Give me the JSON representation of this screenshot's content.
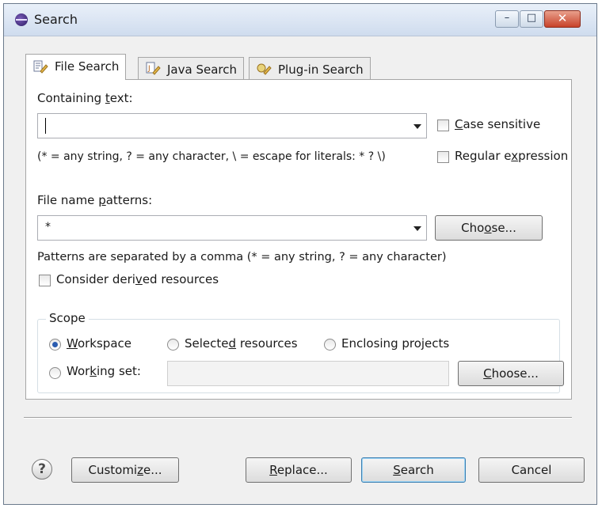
{
  "window": {
    "title": "Search"
  },
  "window_controls": {
    "minimize": "–",
    "maximize": "□",
    "close": "✕"
  },
  "tabs": [
    {
      "label": "File Search",
      "icon": "file-search-icon"
    },
    {
      "label": "Java Search",
      "icon": "java-search-icon"
    },
    {
      "label": "Plug-in Search",
      "icon": "plugin-search-icon"
    }
  ],
  "containing_text": {
    "label_pre": "Containing ",
    "label_mn": "t",
    "label_post": "ext:",
    "value": "",
    "hint": "(* = any string, ? = any character, \\ = escape for literals: * ? \\)"
  },
  "case_sensitive": {
    "mn": "C",
    "rest": "ase sensitive",
    "checked": false
  },
  "regex": {
    "pre": "Regular e",
    "mn": "x",
    "post": "pression",
    "checked": false
  },
  "file_patterns": {
    "label_pre": "File name ",
    "label_mn": "p",
    "label_post": "atterns:",
    "value": "*",
    "choose_pre": "Cho",
    "choose_mn": "o",
    "choose_post": "se...",
    "hint": "Patterns are separated by a comma (* = any string, ? = any character)"
  },
  "derived": {
    "pre": "Consider deri",
    "mn": "v",
    "post": "ed resources",
    "checked": false
  },
  "scope": {
    "legend": "Scope",
    "workspace": {
      "mn": "W",
      "rest": "orkspace",
      "selected": true
    },
    "selected_resources": {
      "pre": "Selecte",
      "mn": "d",
      "post": " resources",
      "selected": false
    },
    "enclosing_projects": {
      "label": "Enclosing projects",
      "selected": false
    },
    "working_set": {
      "pre": "Wor",
      "mn": "k",
      "post": "ing set:",
      "selected": false,
      "value": ""
    },
    "choose": {
      "mn": "C",
      "rest": "hoose..."
    }
  },
  "buttons": {
    "help": "?",
    "customize": {
      "pre": "Customi",
      "mn": "z",
      "post": "e..."
    },
    "replace": {
      "mn": "R",
      "rest": "eplace..."
    },
    "search": {
      "mn": "S",
      "rest": "earch"
    },
    "cancel": "Cancel"
  },
  "colors": {
    "title_bar": "#cfdcee",
    "close_button": "#c8432a",
    "default_button_border": "#3c7fb1"
  }
}
